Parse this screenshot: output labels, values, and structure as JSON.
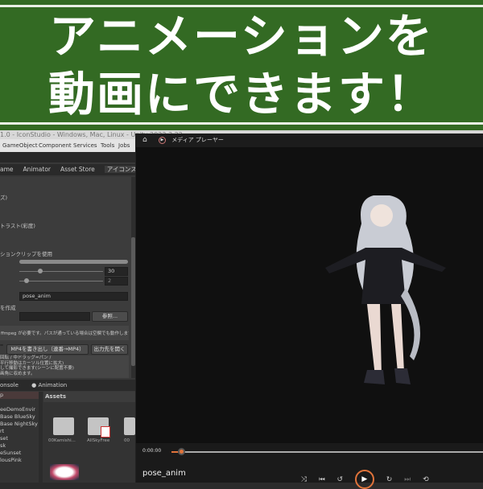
{
  "banner": {
    "line1": "アニメーションを",
    "line2": "動画にできます！",
    "bg_color": "#336a23"
  },
  "unity": {
    "title": "1.0 - IconStudio - Windows, Mac, Linux - Unity 2022.3.22",
    "menu": [
      "GameObject",
      "Component",
      "Services",
      "Tools",
      "Jobs"
    ],
    "tabs": [
      "ame",
      "Animator",
      "Asset Store",
      "アイコンスタ"
    ],
    "inspector": {
      "label1": "ズ)",
      "label2": "トラスト(彩度)",
      "label3": "ションクリップを使用",
      "slider1_value": "30",
      "slider2_value": "2",
      "filename": "pose_anim",
      "label4": "を作成",
      "browse": "参照...",
      "ffmpeg_note": "ffmpeg が必要です。パスが通っている場合は空欄でも動作します。",
      "export_button": "MP4を書き出し（連番→MP4）",
      "open_button": "出力先を開く",
      "help": [
        "回転 / 中ドラッグ=パン /",
        "平行移動はカーソル位置に拡大)",
        "して撮影できます(シーンに配置不要)",
        "画角に収めます。"
      ]
    },
    "bottom_tabs": [
      "onsole",
      "Animation"
    ],
    "project": {
      "tree": [
        "p",
        "",
        "eeDemoEnvir",
        "Base BlueSky",
        "Base NightSky",
        "rt",
        "set",
        "sk",
        "eSunset",
        "lousPink"
      ],
      "assets_label": "Assets",
      "assets": [
        "00Kamishi...",
        "AllSkyFree",
        "00"
      ]
    }
  },
  "player": {
    "title": "メディア プレーヤー",
    "time": "0:00:00",
    "progress": 0.03,
    "media_title": "pose_anim",
    "accent": "#e0733a"
  }
}
